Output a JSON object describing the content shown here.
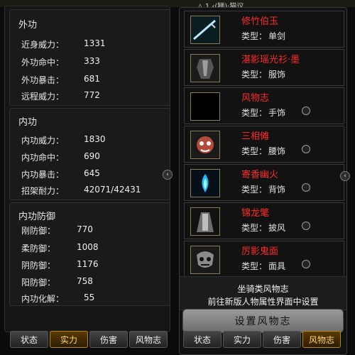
{
  "left": {
    "outer": {
      "title": "外功",
      "stats": [
        {
          "label": "近身威力：",
          "value": "1331"
        },
        {
          "label": "外功命中：",
          "value": "333"
        },
        {
          "label": "外功暴击：",
          "value": "681"
        },
        {
          "label": "远程威力：",
          "value": "772"
        }
      ]
    },
    "inner": {
      "title": "内功",
      "stats": [
        {
          "label": "内功威力：",
          "value": "1830"
        },
        {
          "label": "内功命中：",
          "value": "690"
        },
        {
          "label": "内功暴击：",
          "value": "645"
        },
        {
          "label": "招架耐力：",
          "value": "42071/42431"
        }
      ]
    },
    "defense": {
      "title": "内功防御",
      "stats": [
        {
          "label": "刚防御：",
          "value": "770"
        },
        {
          "label": "柔防御：",
          "value": "1008"
        },
        {
          "label": "阴防御：",
          "value": "1176"
        },
        {
          "label": "阳防御：",
          "value": "758"
        },
        {
          "label": "内功化解：",
          "value": "55"
        }
      ]
    },
    "tabs": [
      "状态",
      "实力",
      "伤害",
      "风物志"
    ],
    "active_tab": "实力"
  },
  "right": {
    "header": "△ 1 ‹(狮)·猫议",
    "items": [
      {
        "name": "修竹伯玉",
        "type_label": "类型：",
        "type_value": "单剑",
        "radio": false,
        "icon": "sword-icon"
      },
      {
        "name": "湛影瑶光衫·墨",
        "type_label": "类型：",
        "type_value": "服饰",
        "radio": false,
        "icon": "armor-icon"
      },
      {
        "name": "风物志",
        "type_label": "类型：",
        "type_value": "手饰",
        "radio": true,
        "icon": "empty-icon"
      },
      {
        "name": "三相傩",
        "type_label": "类型：",
        "type_value": "腰饰",
        "radio": true,
        "icon": "mask-icon"
      },
      {
        "name": "寄香幽火",
        "type_label": "类型：",
        "type_value": "背饰",
        "radio": true,
        "icon": "flame-icon"
      },
      {
        "name": "锦龙氅",
        "type_label": "类型：",
        "type_value": "披风",
        "radio": true,
        "icon": "cape-icon"
      },
      {
        "name": "厉影鬼面",
        "type_label": "类型：",
        "type_value": "面具",
        "radio": true,
        "icon": "demon-mask-icon"
      }
    ],
    "info_line1": "坐骑类风物志",
    "info_line2": "前往新版人物属性界面中设置",
    "setup_button": "设置风物志",
    "tabs": [
      "状态",
      "实力",
      "伤害",
      "风物志"
    ],
    "active_tab": "风物志"
  }
}
